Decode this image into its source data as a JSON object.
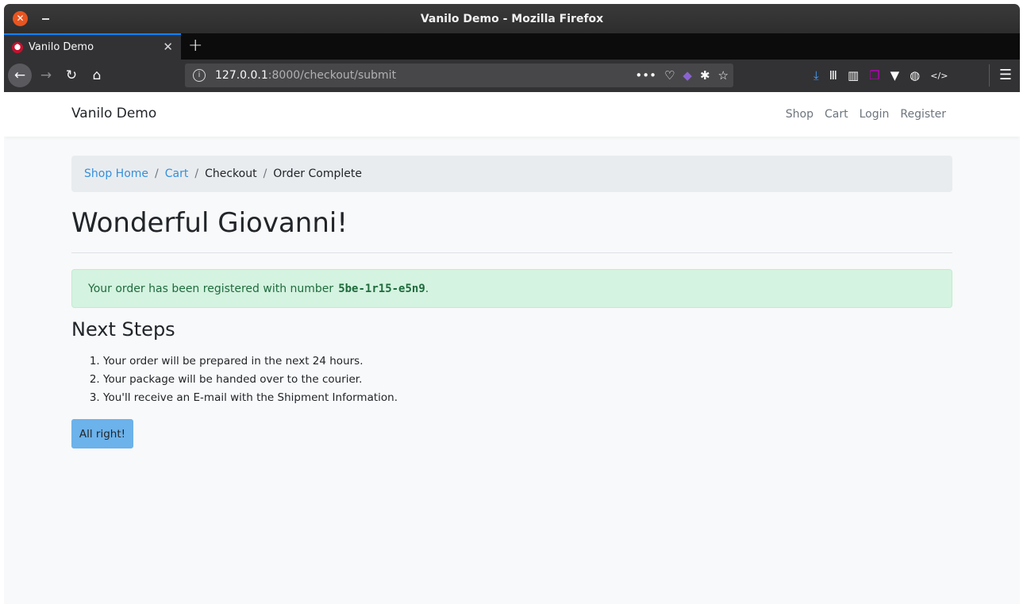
{
  "window": {
    "title": "Vanilo Demo - Mozilla Firefox"
  },
  "tabs": [
    {
      "label": "Vanilo Demo"
    }
  ],
  "toolbar": {
    "url_host": "127.0.0.1",
    "url_rest": ":8000/checkout/submit"
  },
  "site": {
    "brand": "Vanilo Demo",
    "nav": [
      "Shop",
      "Cart",
      "Login",
      "Register"
    ]
  },
  "breadcrumb": {
    "shop_home": "Shop Home",
    "cart": "Cart",
    "checkout": "Checkout",
    "order_complete": "Order Complete",
    "separator": "/"
  },
  "main": {
    "heading": "Wonderful Giovanni!",
    "alert_prefix": "Your order has been registered with number",
    "order_number": "5be-1r15-e5n9",
    "alert_suffix": ".",
    "next_steps_title": "Next Steps",
    "steps": [
      "Your order will be prepared in the next 24 hours.",
      "Your package will be handed over to the courier.",
      "You'll receive an E-mail with the Shipment Information."
    ],
    "button_label": "All right!"
  },
  "colors": {
    "link": "#3490dc",
    "primary_button": "#6cb2eb",
    "alert_bg": "#d4f3e0",
    "alert_text": "#1f6b3d",
    "tab_accent": "#0a84ff"
  }
}
